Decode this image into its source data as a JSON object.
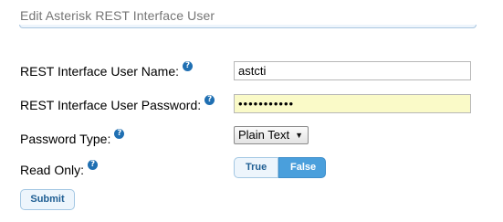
{
  "section": {
    "title": "Edit Asterisk REST Interface User"
  },
  "form": {
    "username": {
      "label": "REST Interface User Name:",
      "value": "astcti",
      "help_icon": "question-mark-icon"
    },
    "password": {
      "label": "REST Interface User Password:",
      "value": "•••••••••••",
      "help_icon": "question-mark-icon"
    },
    "password_type": {
      "label": "Password Type:",
      "selected": "Plain Text",
      "help_icon": "question-mark-icon",
      "arrow_icon": "triangle-down-icon"
    },
    "read_only": {
      "label": "Read Only:",
      "help_icon": "question-mark-icon",
      "options": [
        "True",
        "False"
      ],
      "selected": "False"
    },
    "submit_label": "Submit"
  },
  "colors": {
    "accent": "#4a9fdc",
    "help_icon": "#1f6fb2",
    "password_background": "#fafac8",
    "title_text": "#757575"
  }
}
